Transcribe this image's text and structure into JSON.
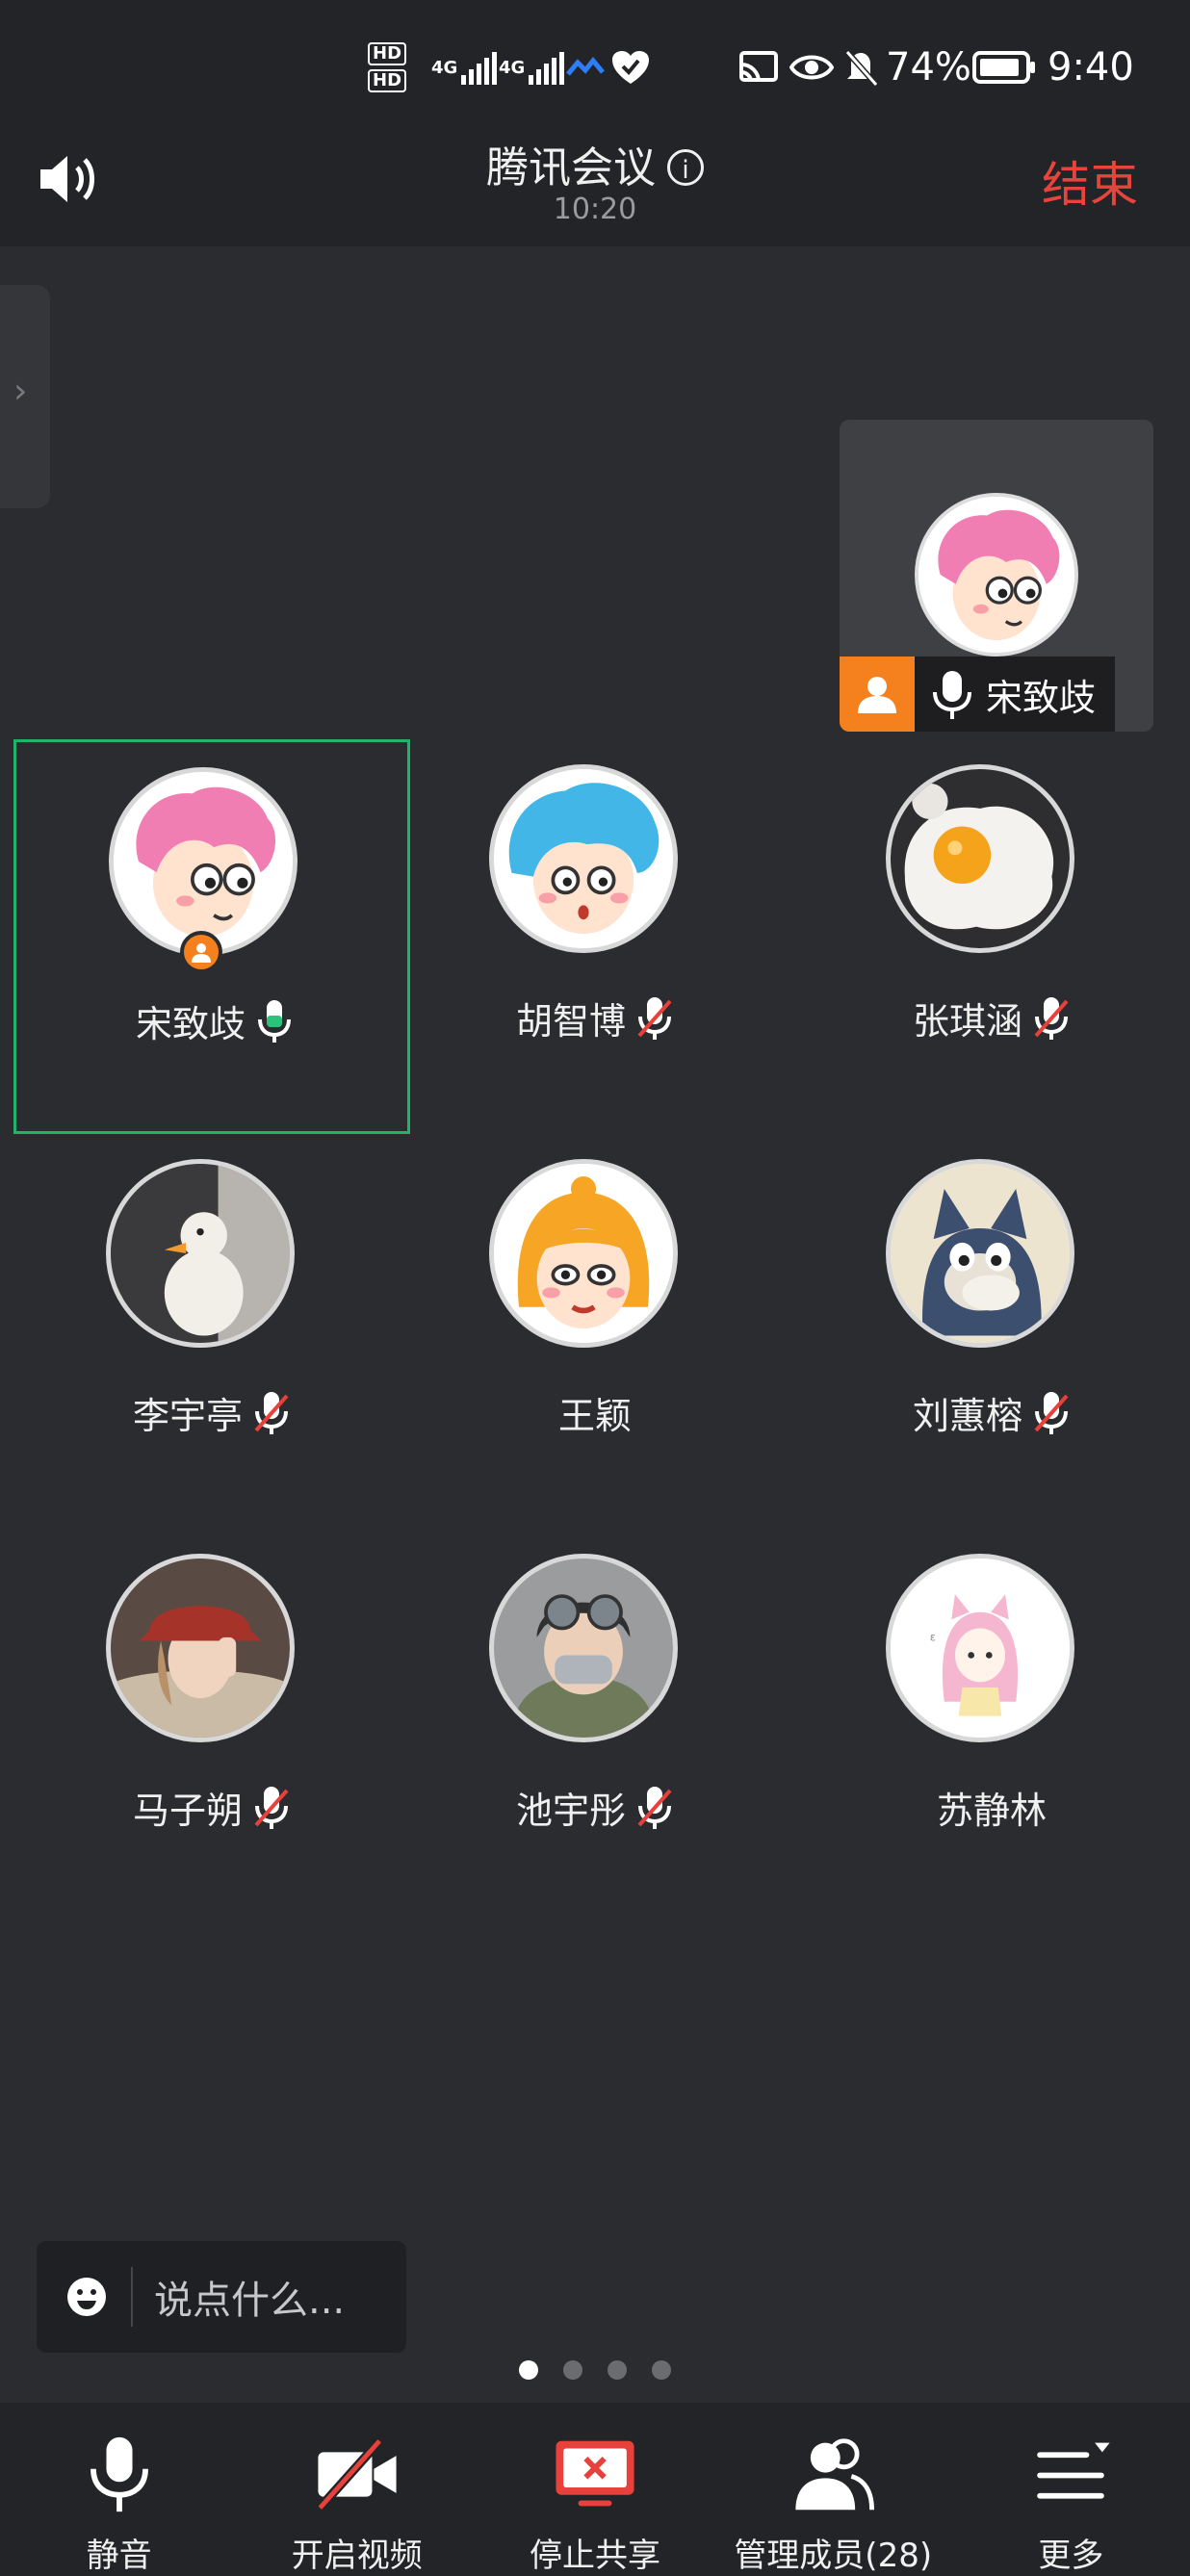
{
  "status_bar": {
    "network_1": "4G",
    "network_2": "4G",
    "battery": "74%",
    "time": "9:40",
    "hd_label": "HD"
  },
  "header": {
    "title": "腾讯会议",
    "elapsed": "10:20",
    "end_label": "结束"
  },
  "floating_window": {
    "name": "宋致歧"
  },
  "participants": [
    {
      "name": "宋致歧",
      "mic": "on",
      "host": true,
      "active": true,
      "avatar": "pink-hair-cartoon"
    },
    {
      "name": "胡智博",
      "mic": "muted",
      "avatar": "blue-hair-cartoon"
    },
    {
      "name": "张琪涵",
      "mic": "muted",
      "avatar": "fried-egg-photo"
    },
    {
      "name": "李宇亭",
      "mic": "muted",
      "avatar": "goose-plush-photo"
    },
    {
      "name": "王颖",
      "mic": "none",
      "avatar": "orange-hair-cartoon"
    },
    {
      "name": "刘蕙榕",
      "mic": "muted",
      "avatar": "tom-cat-cartoon"
    },
    {
      "name": "马子朔",
      "mic": "muted",
      "avatar": "red-hat-photo"
    },
    {
      "name": "池宇彤",
      "mic": "muted",
      "avatar": "helmet-mask-photo"
    },
    {
      "name": "苏静林",
      "mic": "none",
      "avatar": "pink-cat-girl-drawing"
    }
  ],
  "chat": {
    "placeholder": "说点什么..."
  },
  "pager": {
    "pages": 4,
    "current": 1
  },
  "toolbar": {
    "mute_label": "静音",
    "video_label": "开启视频",
    "share_label": "停止共享",
    "members_label": "管理成员(28)",
    "more_label": "更多"
  },
  "colors": {
    "background": "#2b2c30",
    "bar": "#232427",
    "end_red": "#e9443c",
    "host_orange": "#f4801e",
    "active_green": "#21b36a",
    "mic_green": "#2bc37a",
    "share_red": "#e8403a"
  }
}
